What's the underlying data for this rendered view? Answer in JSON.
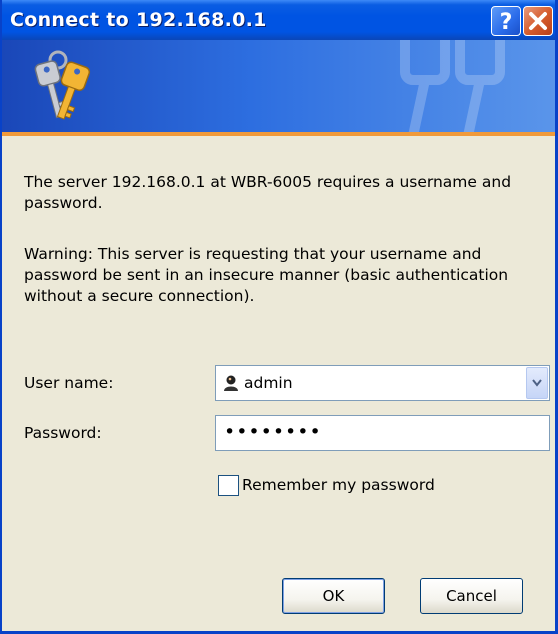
{
  "window": {
    "title": "Connect to 192.168.0.1",
    "help_icon": "help-icon",
    "close_icon": "close-icon"
  },
  "banner": {
    "icon": "keys-icon",
    "accent_color": "#f09a3a"
  },
  "message": {
    "server_info": "The server 192.168.0.1 at WBR-6005 requires a username and password.",
    "warning": "Warning: This server is requesting that your username and password be sent in an insecure manner (basic authentication without a secure connection)."
  },
  "form": {
    "username_label": "User name:",
    "username_value": "admin",
    "password_label": "Password:",
    "password_value": "••••••••",
    "remember_label": "Remember my password",
    "remember_checked": false
  },
  "buttons": {
    "ok": "OK",
    "cancel": "Cancel"
  }
}
